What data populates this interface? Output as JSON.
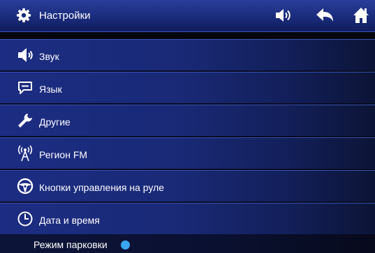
{
  "header": {
    "title": "Настройки",
    "icons": [
      "gear-icon",
      "volume-icon",
      "back-arrow-icon",
      "home-icon"
    ]
  },
  "menu": {
    "items": [
      {
        "label": "Звук",
        "icon": "speaker-icon"
      },
      {
        "label": "Язык",
        "icon": "speech-bubble-icon"
      },
      {
        "label": "Другие",
        "icon": "wrench-icon"
      },
      {
        "label": "Регион FM",
        "icon": "antenna-icon"
      },
      {
        "label": "Кнопки управления на руле",
        "icon": "steering-wheel-icon"
      },
      {
        "label": "Дата и время",
        "icon": "clock-icon"
      }
    ]
  },
  "footer": {
    "label": "Режим парковки",
    "indicator_color": "#39a6f0"
  },
  "colors": {
    "header_bg": "#1a2b7c",
    "item_bg": "#1c2c82",
    "text": "#ffffff"
  }
}
